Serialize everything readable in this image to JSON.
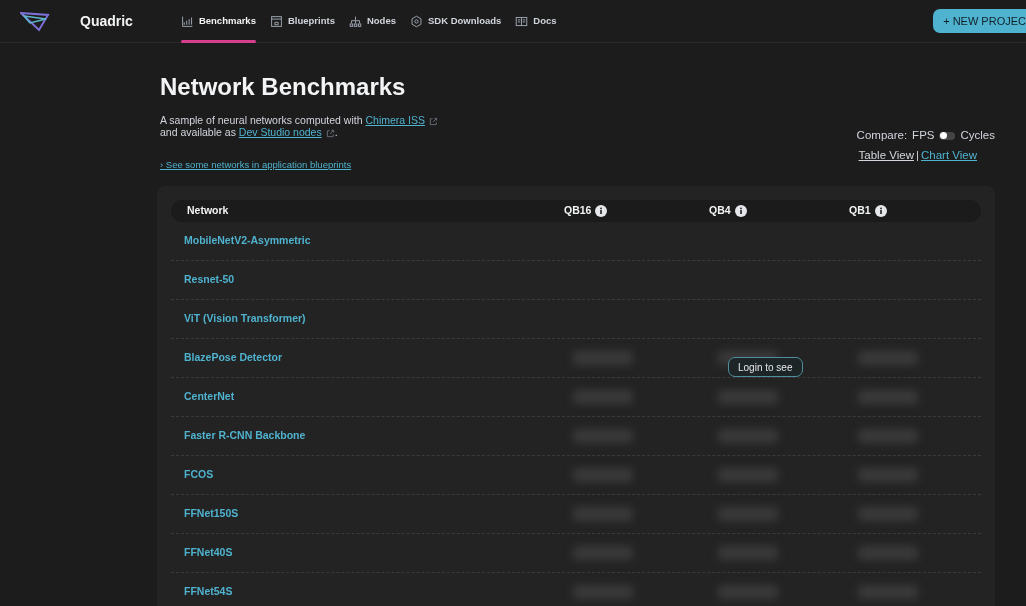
{
  "brand": "Quadric",
  "nav": [
    {
      "label": "Benchmarks",
      "kind": "chart",
      "selected": true
    },
    {
      "label": "Blueprints",
      "kind": "blueprint",
      "selected": false
    },
    {
      "label": "Nodes",
      "kind": "nodes",
      "selected": false
    },
    {
      "label": "SDK Downloads",
      "kind": "sdk",
      "selected": false
    },
    {
      "label": "Docs",
      "kind": "docs",
      "selected": false
    }
  ],
  "new_project_button": "+ NEW PROJEC",
  "title": "Network Benchmarks",
  "intro": {
    "before": "A sample of neural networks computed with",
    "link1": "Chimera ISS",
    "middle": "and available as",
    "link2": "Dev Studio nodes",
    "after": "."
  },
  "blueprints_link": "› See some networks in application blueprints",
  "compare": {
    "label": "Compare:",
    "left": "FPS",
    "right": "Cycles",
    "on": false
  },
  "views": [
    {
      "label": "Table View",
      "selected": true
    },
    {
      "label": "Chart View",
      "selected": false
    }
  ],
  "view_separator": "|",
  "table": {
    "columns": [
      "Network",
      "QB16",
      "QB4",
      "QB1"
    ],
    "rows": [
      {
        "name": "MobileNetV2-Asymmetric",
        "locked": false
      },
      {
        "name": "Resnet-50",
        "locked": false
      },
      {
        "name": "ViT (Vision Transformer)",
        "locked": false
      },
      {
        "name": "BlazePose Detector",
        "locked": true
      },
      {
        "name": "CenterNet",
        "locked": true
      },
      {
        "name": "Faster R-CNN Backbone",
        "locked": true
      },
      {
        "name": "FCOS",
        "locked": true
      },
      {
        "name": "FFNet150S",
        "locked": true
      },
      {
        "name": "FFNet40S",
        "locked": true
      },
      {
        "name": "FFNet54S",
        "locked": true
      }
    ]
  },
  "login_button": "Login to see"
}
